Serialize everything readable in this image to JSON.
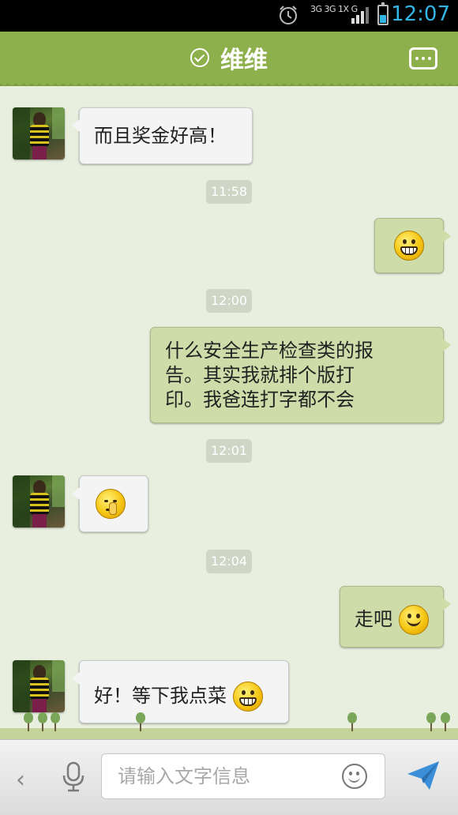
{
  "status_bar": {
    "network_label": "3G 3G 1X G",
    "time": "12:07",
    "colors": {
      "accent": "#33b5e5"
    }
  },
  "header": {
    "title": "维维",
    "colors": {
      "background": "#8db04d"
    }
  },
  "messages": [
    {
      "side": "left",
      "type": "text",
      "text": "而且奖金好高！"
    },
    {
      "type": "timestamp",
      "text": "11:58"
    },
    {
      "side": "right",
      "type": "emoji",
      "emoji": "grin-emoji"
    },
    {
      "type": "timestamp",
      "text": "12:00"
    },
    {
      "side": "right",
      "type": "text",
      "lines": [
        "什么安全生产检查类的报",
        "告。其实我就排个版打",
        "印。我爸连打字都不会"
      ]
    },
    {
      "type": "timestamp",
      "text": "12:01"
    },
    {
      "side": "left",
      "type": "emoji",
      "emoji": "nose-pick-emoji"
    },
    {
      "type": "timestamp",
      "text": "12:04"
    },
    {
      "side": "right",
      "type": "text",
      "text": "走吧",
      "emoji": "smile-emoji"
    },
    {
      "side": "left",
      "type": "text",
      "text": "好！等下我点菜",
      "emoji": "grin-emoji"
    }
  ],
  "input_bar": {
    "placeholder": "请输入文字信息",
    "icons": [
      "chevron-left-icon",
      "microphone-icon",
      "smiley-icon",
      "send-icon"
    ]
  }
}
